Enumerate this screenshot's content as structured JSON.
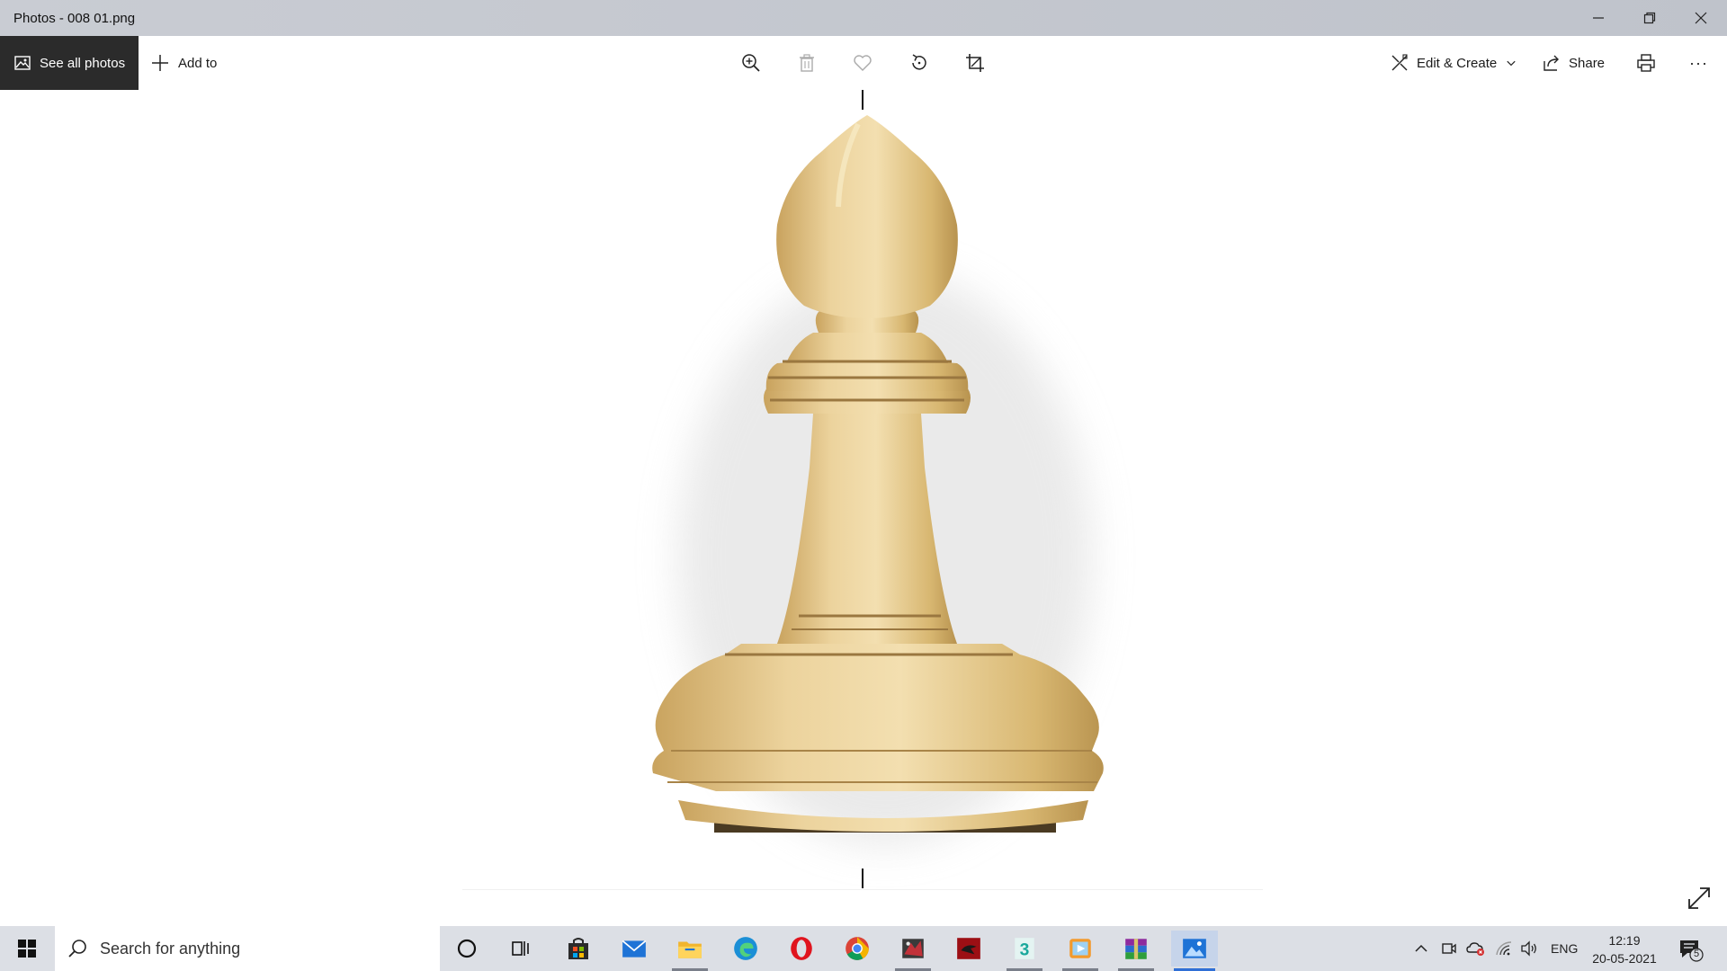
{
  "window": {
    "title": "Photos - 008 01.png"
  },
  "toolbar": {
    "see_all_photos": "See all photos",
    "add_to": "Add to",
    "edit_create": "Edit & Create",
    "share": "Share",
    "more": "···"
  },
  "taskbar": {
    "search_placeholder": "Search for anything",
    "language": "ENG",
    "time": "12:19",
    "date": "20-05-2021",
    "notification_count": "5"
  },
  "colors": {
    "accent": "#2f6fd6",
    "piece_light": "#ecd39d",
    "piece_mid": "#d8b771",
    "piece_dark": "#b8934f"
  }
}
